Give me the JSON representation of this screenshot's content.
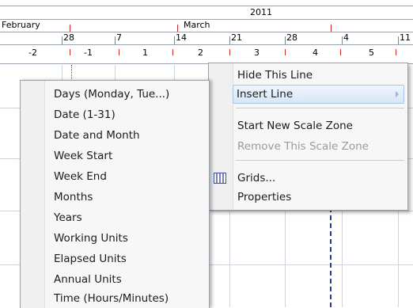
{
  "timescale": {
    "year": "2011",
    "months": [
      "February",
      "March"
    ],
    "week_dates": [
      "28",
      "7",
      "14",
      "21",
      "28",
      "4",
      "11"
    ],
    "week_numbers": [
      "-2",
      "-1",
      "1",
      "2",
      "3",
      "4",
      "5"
    ]
  },
  "line_menu": {
    "items": [
      {
        "label": "Hide This Line",
        "enabled": true
      },
      {
        "label": "Insert Line",
        "enabled": true,
        "highlighted": true,
        "has_submenu": true
      },
      {
        "label": "Start New Scale Zone",
        "enabled": true
      },
      {
        "label": "Remove This Scale Zone",
        "enabled": false
      },
      {
        "label": "Grids...",
        "enabled": true,
        "icon": "grid-icon"
      },
      {
        "label": "Properties",
        "enabled": true
      }
    ]
  },
  "insert_submenu": {
    "items": [
      {
        "label": "Days (Monday, Tue...)"
      },
      {
        "label": "Date (1-31)"
      },
      {
        "label": "Date and Month"
      },
      {
        "label": "Week Start"
      },
      {
        "label": "Week End"
      },
      {
        "label": "Months"
      },
      {
        "label": "Years"
      },
      {
        "label": "Working Units"
      },
      {
        "label": "Elapsed Units"
      },
      {
        "label": "Annual Units"
      },
      {
        "label": "Time (Hours/Minutes)"
      }
    ]
  },
  "colors": {
    "highlight_border": "#a9c4e4",
    "marker_red": "#d62828",
    "dash_blue": "#2b3a8c"
  }
}
